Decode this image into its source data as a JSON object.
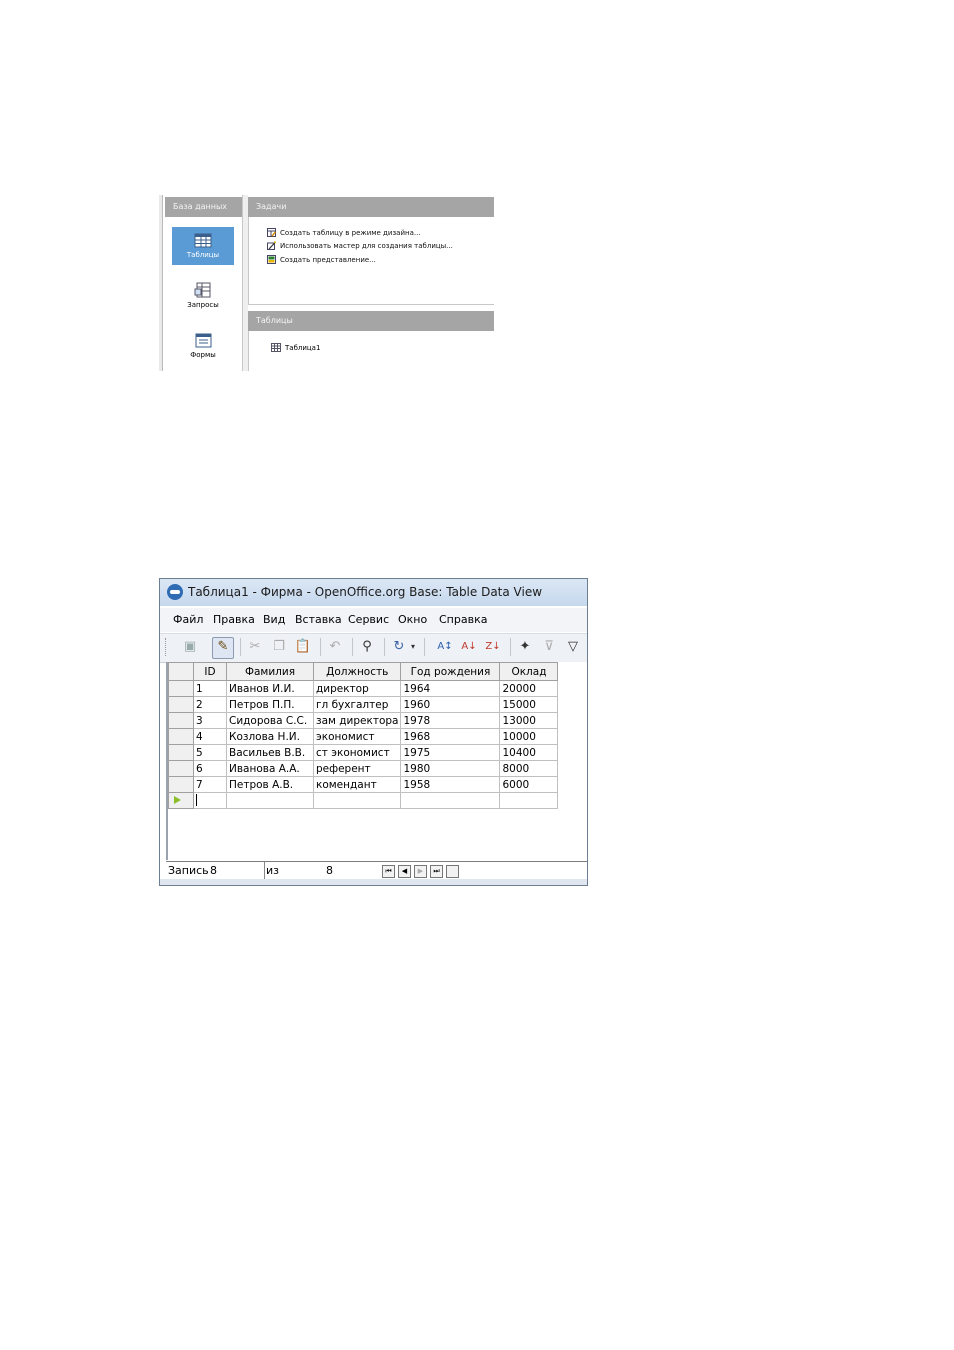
{
  "db_window": {
    "database_header": "База данных",
    "tasks_header": "Задачи",
    "tables_header": "Таблицы",
    "nav_items": [
      {
        "label": "Таблицы",
        "icon": "table-icon",
        "selected": true
      },
      {
        "label": "Запросы",
        "icon": "query-icon",
        "selected": false
      },
      {
        "label": "Формы",
        "icon": "form-icon",
        "selected": false
      }
    ],
    "tasks": [
      {
        "label": "Создать таблицу в режиме дизайна...",
        "icon": "design-table-icon"
      },
      {
        "label": "Использовать мастер для создания таблицы...",
        "icon": "wizard-icon"
      },
      {
        "label": "Создать представление...",
        "icon": "view-icon"
      }
    ],
    "table_items": [
      {
        "label": "Таблица1",
        "icon": "table-small-icon"
      }
    ]
  },
  "data_view": {
    "title": "Таблица1 - Фирма - OpenOffice.org Base: Table Data View",
    "menu": [
      "Файл",
      "Правка",
      "Вид",
      "Вставка",
      "Сервис",
      "Окно",
      "Справка"
    ],
    "toolbar_icons": [
      "save-icon",
      "edit-icon",
      "cut-icon",
      "copy-icon",
      "paste-icon",
      "undo-icon",
      "find-icon",
      "refresh-icon",
      "dropdown-icon",
      "sort-icon",
      "sort-ascending-icon",
      "sort-descending-icon",
      "autofilter-icon",
      "standard-filter-icon",
      "filter-icon"
    ],
    "columns": [
      "ID",
      "Фамилия",
      "Должность",
      "Год рождения",
      "Оклад"
    ],
    "rows": [
      [
        "1",
        "Иванов И.И.",
        "директор",
        "1964",
        "20000"
      ],
      [
        "2",
        "Петров П.П.",
        "гл бухгалтер",
        "1960",
        "15000"
      ],
      [
        "3",
        "Сидорова С.С.",
        "зам директора",
        "1978",
        "13000"
      ],
      [
        "4",
        "Козлова Н.И.",
        "экономист",
        "1968",
        "10000"
      ],
      [
        "5",
        "Васильев В.В.",
        "ст экономист",
        "1975",
        "10400"
      ],
      [
        "6",
        "Иванова А.А.",
        "референт",
        "1980",
        "8000"
      ],
      [
        "7",
        "Петров А.В.",
        "комендант",
        "1958",
        "6000"
      ]
    ],
    "status": {
      "record_label": "Запись",
      "current_record": "8",
      "of_label": "из",
      "total_records": "8"
    },
    "accent_color": "#2e6db4",
    "new_row_marker_color": "#8bbf2a"
  }
}
